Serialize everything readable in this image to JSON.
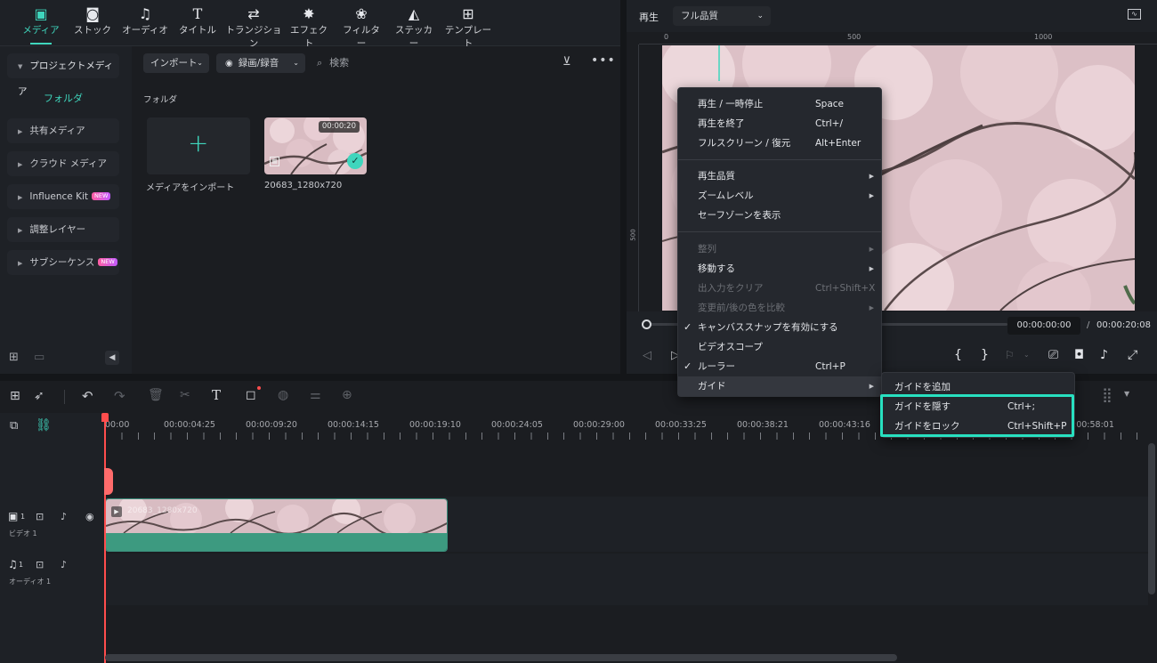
{
  "toolbar": {
    "items": [
      {
        "label": "メディア",
        "icon": "media-icon",
        "glyph": "▣"
      },
      {
        "label": "ストック",
        "icon": "stock-icon",
        "glyph": "◙"
      },
      {
        "label": "オーディオ",
        "icon": "music-note-icon",
        "glyph": "♫"
      },
      {
        "label": "タイトル",
        "icon": "title-t-icon",
        "glyph": "T"
      },
      {
        "label": "トランジション",
        "icon": "transition-icon",
        "glyph": "⇄"
      },
      {
        "label": "エフェクト",
        "icon": "effect-sparkle-icon",
        "glyph": "✸"
      },
      {
        "label": "フィルター",
        "icon": "filter-circles-icon",
        "glyph": "❀"
      },
      {
        "label": "ステッカー",
        "icon": "sticker-icon",
        "glyph": "◭"
      },
      {
        "label": "テンプレート",
        "icon": "template-grid-icon",
        "glyph": "⊞"
      }
    ]
  },
  "sidebar": {
    "project_media": "プロジェクトメディア",
    "folder": "フォルダ",
    "items": [
      {
        "label": "共有メディア",
        "new": false
      },
      {
        "label": "クラウド メディア",
        "new": false
      },
      {
        "label": "Influence Kit",
        "new": true
      },
      {
        "label": "調整レイヤー",
        "new": false
      },
      {
        "label": "サブシーケンス",
        "new": true
      }
    ],
    "new_badge": "NEW"
  },
  "media": {
    "import_label": "インポート",
    "record_label": "録画/録音",
    "search_placeholder": "検索",
    "folder_heading": "フォルダ",
    "import_tile_label": "メディアをインポート",
    "clip_name": "20683_1280x720",
    "clip_duration": "00:00:20"
  },
  "preview": {
    "play_label": "再生",
    "quality": "フル品質",
    "ruler_marks": [
      "0",
      "500",
      "1000"
    ],
    "ruler_left_mark": "500",
    "current_time": "00:00:00:00",
    "separator": "/",
    "total_time": "00:00:20:08"
  },
  "context_menu": {
    "groups": [
      [
        {
          "label": "再生 / 一時停止",
          "shortcut": "Space"
        },
        {
          "label": "再生を終了",
          "shortcut": "Ctrl+/"
        },
        {
          "label": "フルスクリーン / 復元",
          "shortcut": "Alt+Enter"
        }
      ],
      [
        {
          "label": "再生品質",
          "submenu": true
        },
        {
          "label": "ズームレベル",
          "submenu": true
        },
        {
          "label": "セーフゾーンを表示"
        }
      ],
      [
        {
          "label": "整列",
          "submenu": true,
          "disabled": true
        },
        {
          "label": "移動する",
          "submenu": true
        },
        {
          "label": "出入力をクリア",
          "shortcut": "Ctrl+Shift+X",
          "disabled": true
        },
        {
          "label": "変更前/後の色を比較",
          "submenu": true,
          "disabled": true
        },
        {
          "label": "キャンバススナップを有効にする",
          "checked": true
        },
        {
          "label": "ビデオスコープ"
        },
        {
          "label": "ルーラー",
          "shortcut": "Ctrl+P",
          "checked": true
        },
        {
          "label": "ガイド",
          "submenu": true,
          "highlighted": true
        }
      ]
    ],
    "check_glyph": "✓",
    "arrow_glyph": "▶"
  },
  "guide_submenu": {
    "items": [
      {
        "label": "ガイドを追加",
        "shortcut": ""
      },
      {
        "label": "ガイドを隠す",
        "shortcut": "Ctrl+;"
      },
      {
        "label": "ガイドをロック",
        "shortcut": "Ctrl+Shift+P"
      }
    ]
  },
  "timeline": {
    "ruler_labels": [
      "00:00",
      "00:00:04:25",
      "00:00:09:20",
      "00:00:14:15",
      "00:00:19:10",
      "00:00:24:05",
      "00:00:29:00",
      "00:00:33:25",
      "00:00:38:21",
      "00:00:43:16",
      ":00:58:01"
    ],
    "video_track_label": "ビデオ 1",
    "video_track_num": "1",
    "audio_track_label": "オーディオ 1",
    "audio_track_num": "1",
    "clip_name": "20683_1280x720"
  },
  "colors": {
    "accent": "#3fd6bd",
    "highlight_box": "#28e0c0",
    "playhead": "#ff4d4d",
    "clip_audio": "#3d9a80"
  }
}
